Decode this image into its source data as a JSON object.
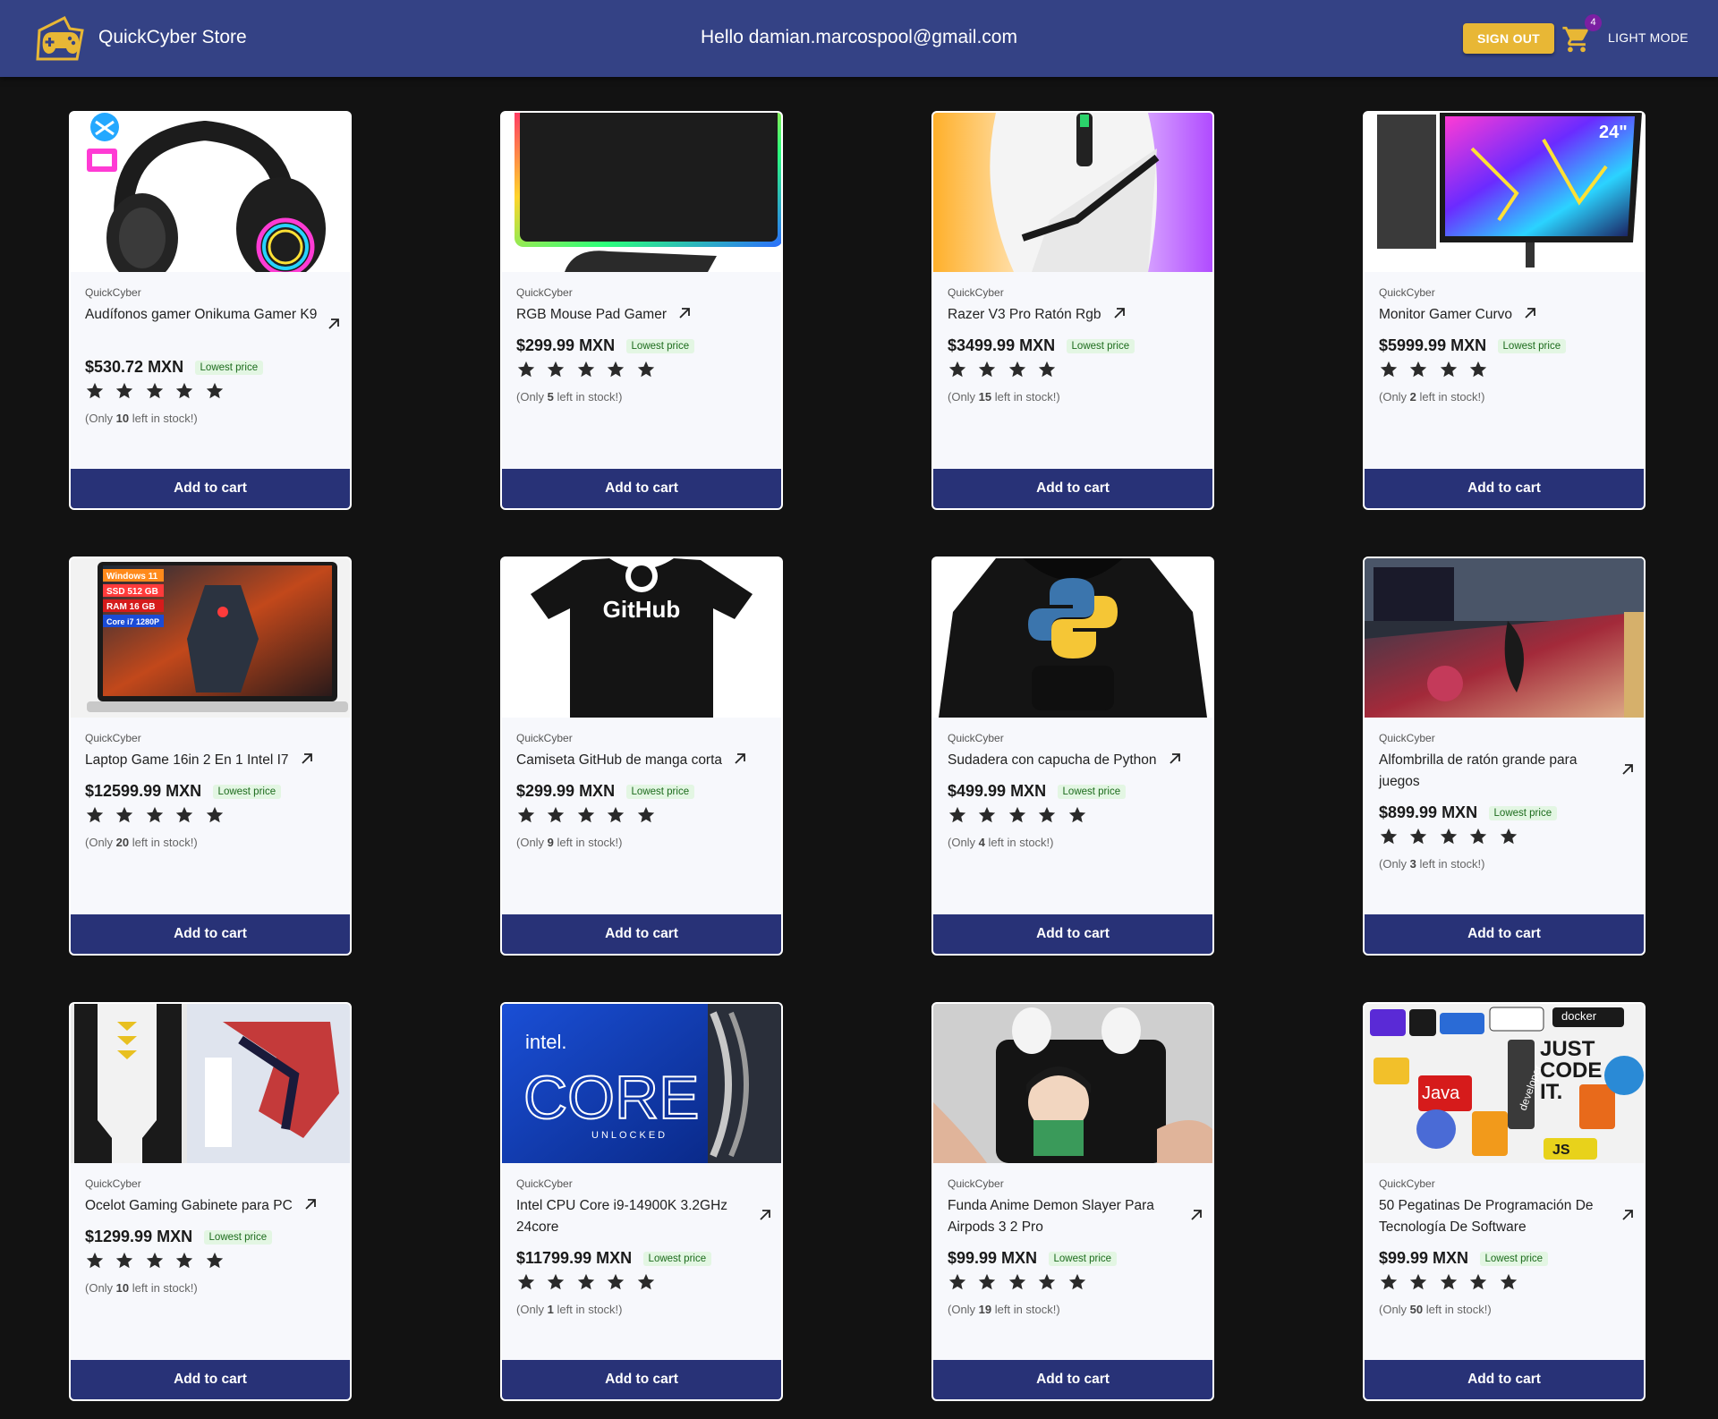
{
  "header": {
    "store_name": "QuickCyber Store",
    "greeting": "Hello damian.marcospool@gmail.com",
    "sign_out": "SIGN OUT",
    "cart_count": "4",
    "mode_toggle": "LIGHT MODE",
    "bar_color": "#344285",
    "accent_color": "#e8b735"
  },
  "products": [
    {
      "brand": "QuickCyber",
      "title": "Audífonos gamer Onikuma Gamer K9",
      "price": "$530.72 MXN",
      "badge": "Lowest price",
      "stock_pre": "(Only ",
      "stock_count": "10",
      "stock_post": " left in stock!)",
      "button": "Add to cart",
      "image": "headset-image"
    },
    {
      "brand": "QuickCyber",
      "title": "RGB Mouse Pad Gamer",
      "price": "$299.99 MXN",
      "badge": "Lowest price",
      "stock_pre": "(Only ",
      "stock_count": "5",
      "stock_post": " left in stock!)",
      "button": "Add to cart",
      "image": "mousepad-image"
    },
    {
      "brand": "QuickCyber",
      "title": "Razer V3 Pro Ratón Rgb",
      "price": "$3499.99 MXN",
      "badge": "Lowest price",
      "stock_pre": "(Only ",
      "stock_count": "15",
      "stock_post": " left in stock!)",
      "button": "Add to cart",
      "image": "mouse-image"
    },
    {
      "brand": "QuickCyber",
      "title": "Monitor Gamer Curvo",
      "price": "$5999.99 MXN",
      "badge": "Lowest price",
      "stock_pre": "(Only ",
      "stock_count": "2",
      "stock_post": " left in stock!)",
      "button": "Add to cart",
      "image": "monitor-image"
    },
    {
      "brand": "QuickCyber",
      "title": "Laptop Game 16in 2 En 1 Intel I7",
      "price": "$12599.99 MXN",
      "badge": "Lowest price",
      "stock_pre": "(Only ",
      "stock_count": "20",
      "stock_post": " left in stock!)",
      "button": "Add to cart",
      "image": "laptop-image"
    },
    {
      "brand": "QuickCyber",
      "title": "Camiseta GitHub de manga corta",
      "price": "$299.99 MXN",
      "badge": "Lowest price",
      "stock_pre": "(Only ",
      "stock_count": "9",
      "stock_post": " left in stock!)",
      "button": "Add to cart",
      "image": "tshirt-image"
    },
    {
      "brand": "QuickCyber",
      "title": "Sudadera con capucha de Python",
      "price": "$499.99 MXN",
      "badge": "Lowest price",
      "stock_pre": "(Only ",
      "stock_count": "4",
      "stock_post": " left in stock!)",
      "button": "Add to cart",
      "image": "hoodie-image"
    },
    {
      "brand": "QuickCyber",
      "title": "Alfombrilla de ratón grande para juegos",
      "price": "$899.99 MXN",
      "badge": "Lowest price",
      "stock_pre": "(Only ",
      "stock_count": "3",
      "stock_post": " left in stock!)",
      "button": "Add to cart",
      "image": "deskmat-image"
    },
    {
      "brand": "QuickCyber",
      "title": "Ocelot Gaming Gabinete para PC",
      "price": "$1299.99 MXN",
      "badge": "Lowest price",
      "stock_pre": "(Only ",
      "stock_count": "10",
      "stock_post": " left in stock!)",
      "button": "Add to cart",
      "image": "pc-case-image"
    },
    {
      "brand": "QuickCyber",
      "title": "Intel CPU Core i9-14900K 3.2GHz 24core",
      "price": "$11799.99 MXN",
      "badge": "Lowest price",
      "stock_pre": "(Only ",
      "stock_count": "1",
      "stock_post": " left in stock!)",
      "button": "Add to cart",
      "image": "cpu-box-image"
    },
    {
      "brand": "QuickCyber",
      "title": "Funda Anime Demon Slayer Para Airpods 3 2 Pro",
      "price": "$99.99 MXN",
      "badge": "Lowest price",
      "stock_pre": "(Only ",
      "stock_count": "19",
      "stock_post": " left in stock!)",
      "button": "Add to cart",
      "image": "airpods-case-image"
    },
    {
      "brand": "QuickCyber",
      "title": "50 Pegatinas De Programación De Tecnología De Software",
      "price": "$99.99 MXN",
      "badge": "Lowest price",
      "stock_pre": "(Only ",
      "stock_count": "50",
      "stock_post": " left in stock!)",
      "button": "Add to cart",
      "image": "stickers-image"
    }
  ],
  "image_text": {
    "laptop_tags": [
      "Windows 11",
      "SSD 512 GB",
      "RAM 16 GB",
      "Core i7 1280P"
    ],
    "tshirt_logo": "GitHub",
    "cpu_brand": "intel.",
    "cpu_model": "CORE",
    "cpu_unlocked": "UNLOCKED",
    "monitor_size": "24\"",
    "sticker_words": [
      "JUST",
      "CODE",
      "IT.",
      "docker",
      "Java",
      "JS",
      "developer"
    ]
  }
}
